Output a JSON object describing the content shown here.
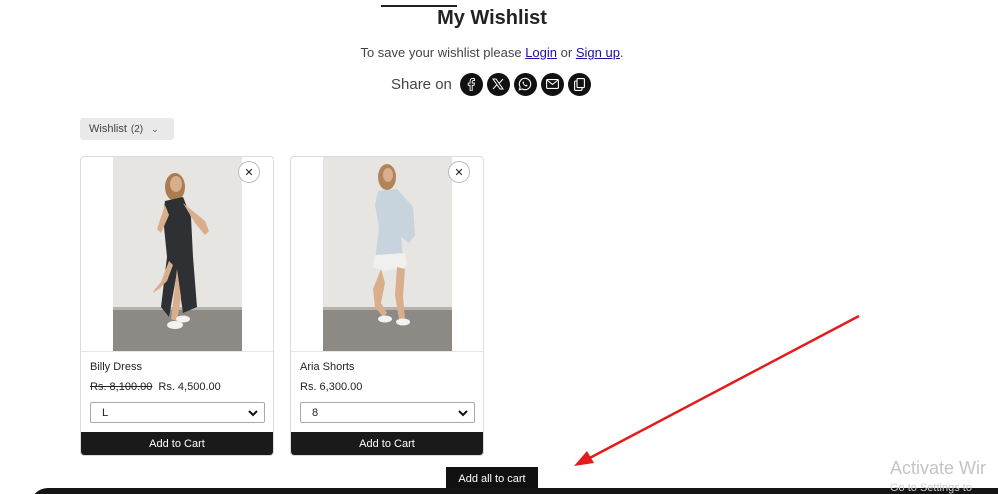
{
  "header": {
    "title": "My Wishlist",
    "login_prefix": "To save your wishlist please",
    "login_link": "Login",
    "login_or": "or",
    "signup_link": "Sign up",
    "login_suffix": "."
  },
  "share": {
    "label": "Share on",
    "icons": [
      "facebook-icon",
      "x-twitter-icon",
      "whatsapp-icon",
      "email-icon",
      "copy-link-icon"
    ]
  },
  "wishlist_select": {
    "label": "Wishlist",
    "count": "(2)"
  },
  "products": [
    {
      "name": "Billy Dress",
      "old_price": "Rs. 8,100.00",
      "price": "Rs. 4,500.00",
      "size": "L",
      "add_label": "Add to Cart"
    },
    {
      "name": "Aria Shorts",
      "old_price": "",
      "price": "Rs. 6,300.00",
      "size": "8",
      "add_label": "Add to Cart"
    }
  ],
  "add_all_label": "Add all to cart",
  "watermark": {
    "title": "Activate Wir",
    "subtitle": "Go to Settings to"
  },
  "colors": {
    "annotation_arrow": "#e31b1b",
    "button_bg": "#1a1a1a",
    "link": "#1a0dab"
  }
}
